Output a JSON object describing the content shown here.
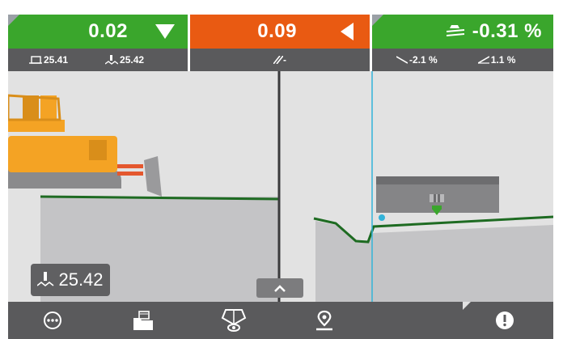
{
  "left_panel": {
    "value": "0.02",
    "stat1": "25.41",
    "stat2": "25.42"
  },
  "center_panel": {
    "value": "0.09",
    "stat": "-"
  },
  "right_panel": {
    "value": "-0.31 %",
    "stat1": "-2.1 %",
    "stat2": "1.1 %"
  },
  "elevation_readout": "25.42",
  "icons": {
    "left_indicator": "triangle-down-icon",
    "center_indicator": "triangle-left-icon",
    "right_header": "slope-layers-icon",
    "bottom": [
      "menu-icon",
      "load-folder-icon",
      "view-mode-icon",
      "location-pin-icon",
      "alert-icon"
    ]
  },
  "colors": {
    "on_grade": "#3aa62c",
    "off_grade": "#e95a12",
    "design_line": "#1e6b22",
    "machine": "#f4a324"
  }
}
